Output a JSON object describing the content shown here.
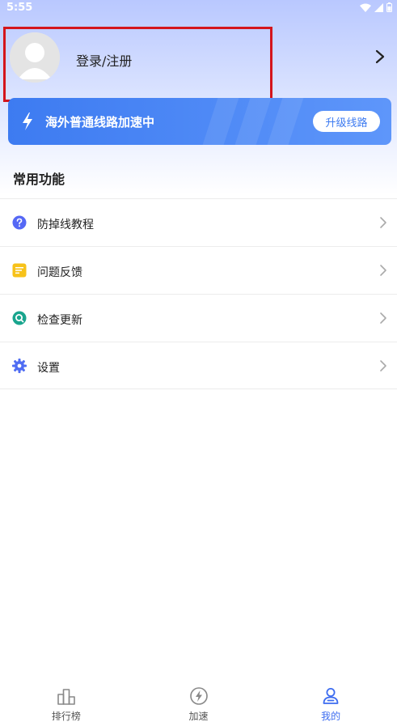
{
  "status_bar": {
    "time": "5:55"
  },
  "profile": {
    "login_label": "登录/注册"
  },
  "banner": {
    "text": "海外普通线路加速中",
    "button_label": "升级线路"
  },
  "section": {
    "title": "常用功能"
  },
  "menu": {
    "items": [
      {
        "label": "防掉线教程",
        "icon": "question-circle-icon",
        "color": "#5568f5"
      },
      {
        "label": "问题反馈",
        "icon": "note-icon",
        "color": "#f7c21a"
      },
      {
        "label": "检查更新",
        "icon": "search-refresh-icon",
        "color": "#19a58e"
      },
      {
        "label": "设置",
        "icon": "gear-icon",
        "color": "#4f6cf3"
      }
    ]
  },
  "tabbar": {
    "items": [
      {
        "label": "排行榜",
        "icon": "ranking-icon"
      },
      {
        "label": "加速",
        "icon": "lightning-circle-icon"
      },
      {
        "label": "我的",
        "icon": "user-icon",
        "active": true
      }
    ]
  },
  "colors": {
    "accent": "#3d6cf0",
    "highlight": "#d4151c"
  }
}
